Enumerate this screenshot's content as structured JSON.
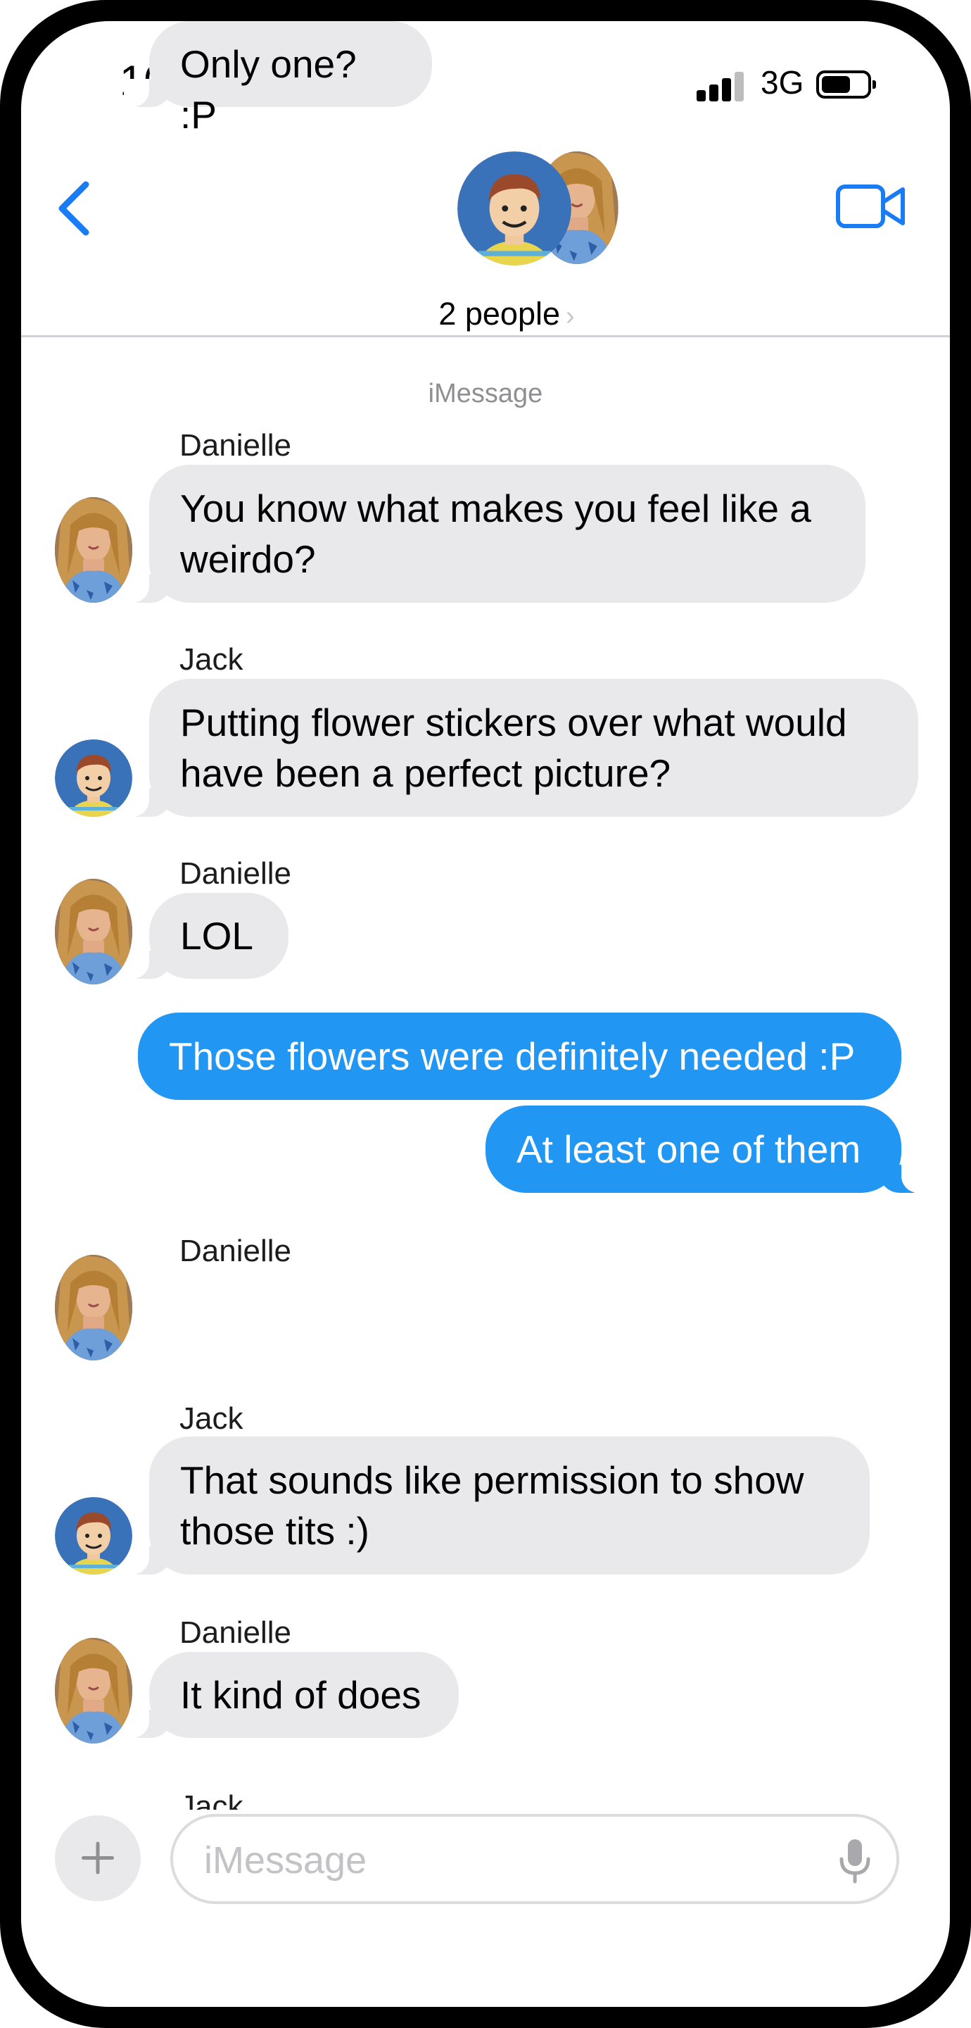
{
  "status_bar": {
    "time": "10:05",
    "network": "3G"
  },
  "header": {
    "people_label": "2 people",
    "chevron": "›"
  },
  "service_label": "iMessage",
  "messages": [
    {
      "sender": "Danielle",
      "text_line1": "You know what makes you feel like a",
      "text_line2": "weirdo?"
    },
    {
      "sender": "Jack",
      "text_line1": "Putting flower stickers over what would",
      "text_line2": "have been a perfect picture?"
    },
    {
      "sender": "Danielle",
      "text": "LOL"
    },
    {
      "text": "Those flowers were definitely needed :P"
    },
    {
      "text": "At least one of them"
    },
    {
      "sender": "Danielle",
      "text": "Only one? :P"
    },
    {
      "sender": "Jack",
      "text_line1": "That sounds like permission to show",
      "text_line2": "those tits :)"
    },
    {
      "sender": "Danielle",
      "text": "It kind of does"
    },
    {
      "sender": "Jack"
    }
  ],
  "compose": {
    "placeholder": "iMessage"
  },
  "colors": {
    "accent": "#1a7cf5",
    "outgoing_bubble": "#2196f3",
    "incoming_bubble": "#e9e9eb"
  },
  "icons": [
    "back-chevron-icon",
    "video-camera-icon",
    "plus-icon",
    "microphone-icon"
  ]
}
